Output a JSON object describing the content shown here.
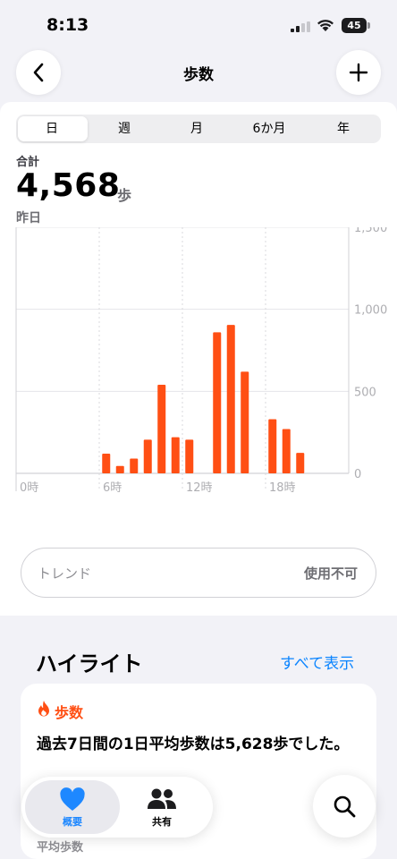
{
  "status_bar": {
    "time": "8:13",
    "battery": "45"
  },
  "nav": {
    "title": "歩数"
  },
  "segments": [
    {
      "label": "日",
      "selected": true
    },
    {
      "label": "週",
      "selected": false
    },
    {
      "label": "月",
      "selected": false
    },
    {
      "label": "6か月",
      "selected": false
    },
    {
      "label": "年",
      "selected": false
    }
  ],
  "summary": {
    "label": "合計",
    "value": "4,568",
    "unit": "歩",
    "date": "昨日"
  },
  "chart_data": {
    "type": "bar",
    "x_tick_labels": [
      "0時",
      "6時",
      "12時",
      "18時"
    ],
    "y_tick_labels": [
      "1,500",
      "1,000",
      "500",
      "0"
    ],
    "ylim": [
      0,
      1500
    ],
    "xlim": [
      0,
      24
    ],
    "color": "#ff4f14",
    "grid": true,
    "bars": [
      {
        "hour": 6.5,
        "value": 120
      },
      {
        "hour": 7.5,
        "value": 45
      },
      {
        "hour": 8.5,
        "value": 90
      },
      {
        "hour": 9.5,
        "value": 205
      },
      {
        "hour": 10.5,
        "value": 540
      },
      {
        "hour": 11.5,
        "value": 220
      },
      {
        "hour": 12.5,
        "value": 205
      },
      {
        "hour": 14.5,
        "value": 860
      },
      {
        "hour": 15.5,
        "value": 905
      },
      {
        "hour": 16.5,
        "value": 620
      },
      {
        "hour": 18.5,
        "value": 330
      },
      {
        "hour": 19.5,
        "value": 270
      },
      {
        "hour": 20.5,
        "value": 125
      }
    ]
  },
  "trend": {
    "label": "トレンド",
    "status": "使用不可"
  },
  "highlights": {
    "title": "ハイライト",
    "show_all": "すべて表示",
    "card": {
      "category": "歩数",
      "text": "過去7日間の1日平均歩数は5,628歩でした。",
      "sub_label": "平均歩数"
    }
  },
  "tab_bar": {
    "tabs": [
      {
        "label": "概要",
        "icon": "heart-icon",
        "selected": true
      },
      {
        "label": "共有",
        "icon": "people-icon",
        "selected": false
      }
    ]
  },
  "colors": {
    "accent": "#ff4f14",
    "link": "#0a84ff",
    "tab_active_icon": "#1e88ff"
  }
}
